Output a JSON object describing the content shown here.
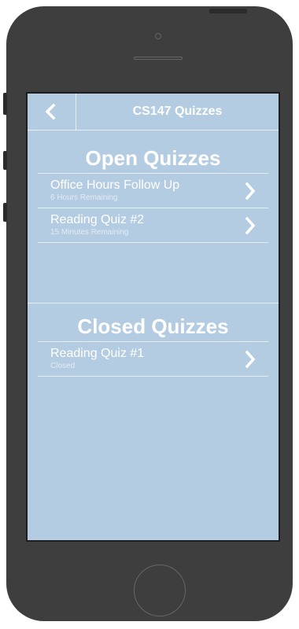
{
  "nav": {
    "title": "CS147 Quizzes",
    "back_icon": "chevron-left-icon"
  },
  "open_section": {
    "title": "Open Quizzes",
    "items": [
      {
        "title": "Office Hours Follow Up",
        "subtitle": "6 Hours Remaining",
        "icon": "chevron-right-icon"
      },
      {
        "title": "Reading Quiz #2",
        "subtitle": "15 Minutes Remaining",
        "icon": "chevron-right-icon"
      }
    ]
  },
  "closed_section": {
    "title": "Closed Quizzes",
    "items": [
      {
        "title": "Reading Quiz #1",
        "subtitle": "Closed",
        "icon": "chevron-right-icon"
      }
    ]
  },
  "colors": {
    "screen_background": "#b4cce2",
    "phone_body": "#3e3e3e",
    "text": "#ffffff"
  }
}
